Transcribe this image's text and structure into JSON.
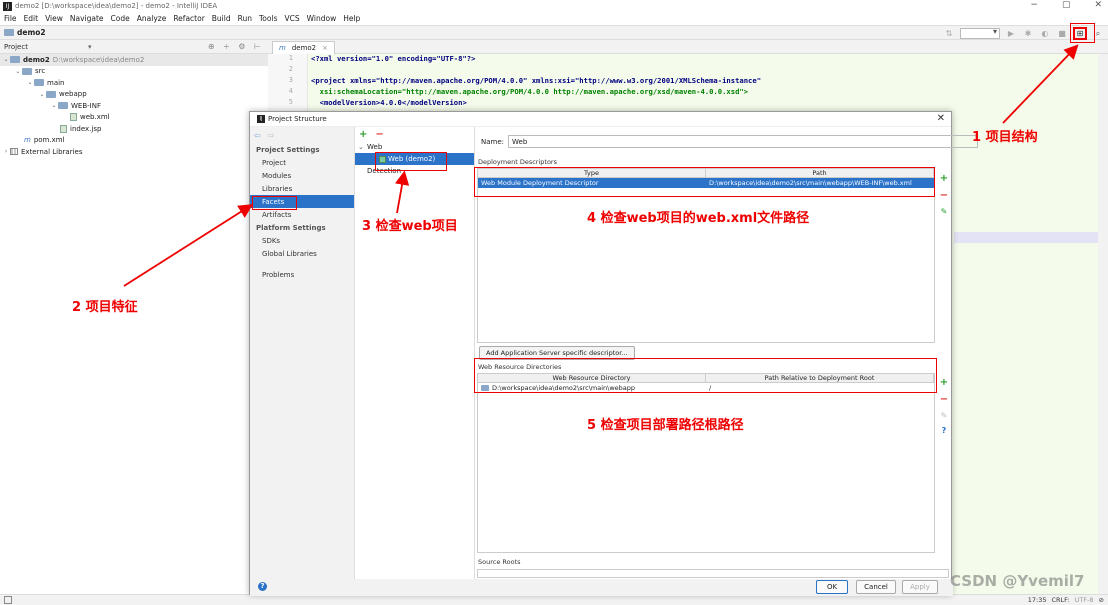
{
  "window": {
    "title": "demo2 [D:\\workspace\\idea\\demo2] - demo2 - IntelliJ IDEA",
    "controls": [
      "−",
      "▢",
      "✕"
    ]
  },
  "menu": [
    "File",
    "Edit",
    "View",
    "Navigate",
    "Code",
    "Analyze",
    "Refactor",
    "Build",
    "Run",
    "Tools",
    "VCS",
    "Window",
    "Help"
  ],
  "navbar": {
    "crumb": "demo2"
  },
  "project_panel": {
    "title": "Project",
    "tree": [
      {
        "label": "demo2",
        "muted": "D:\\workspace\\idea\\demo2"
      },
      {
        "label": "src"
      },
      {
        "label": "main"
      },
      {
        "label": "webapp"
      },
      {
        "label": "WEB-INF"
      },
      {
        "label": "web.xml"
      },
      {
        "label": "index.jsp"
      },
      {
        "label": "pom.xml"
      },
      {
        "label": "External Libraries"
      }
    ]
  },
  "editor": {
    "tab": "demo2",
    "line_numbers": [
      "1",
      "2",
      "3",
      "4",
      "5"
    ],
    "lines": [
      {
        "a": "<?xml version=\"1.0\" encoding=\"UTF-8\"?>"
      },
      {
        "a": ""
      },
      {
        "a": "<project xmlns=\"http://maven.apache.org/POM/4.0.0\" xmlns:xsi=\"http://www.w3.org/2001/XMLSchema-instance\""
      },
      {
        "a": "  xsi:schemaLocation=\"http://maven.apache.org/POM/4.0.0 http://maven.apache.org/xsd/maven-4.0.0.xsd\">"
      },
      {
        "a": "  <modelVersion>4.0.0</modelVersion>"
      }
    ]
  },
  "status": {
    "time": "17:35",
    "crlf": "CRLF:",
    "enc": "UTF-8"
  },
  "dialog": {
    "title": "Project Structure",
    "close": "✕",
    "left": {
      "project_settings": "Project Settings",
      "project_items": [
        "Project",
        "Modules",
        "Libraries",
        "Facets",
        "Artifacts"
      ],
      "platform_settings": "Platform Settings",
      "platform_items": [
        "SDKs",
        "Global Libraries"
      ],
      "problems": "Problems"
    },
    "middle": {
      "web": "Web",
      "facet": "Web (demo2)",
      "detection": "Detection"
    },
    "right": {
      "name_label": "Name:",
      "name_value": "Web",
      "deployment_descriptors": "Deployment Descriptors",
      "dd_headers": [
        "Type",
        "Path"
      ],
      "dd_row": [
        "Web Module Deployment Descriptor",
        "D:\\workspace\\idea\\demo2\\src\\main\\webapp\\WEB-INF\\web.xml"
      ],
      "add_server_btn": "Add Application Server specific descriptor...",
      "web_resource_dirs": "Web Resource Directories",
      "wr_headers": [
        "Web Resource Directory",
        "Path Relative to Deployment Root"
      ],
      "wr_row": [
        "D:\\workspace\\idea\\demo2\\src\\main\\webapp",
        "/"
      ],
      "source_roots": "Source Roots"
    },
    "buttons": {
      "ok": "OK",
      "cancel": "Cancel",
      "apply": "Apply"
    }
  },
  "annotations": {
    "a1": "1 项目结构",
    "a2": "2 项目特征",
    "a3": "3 检查web项目",
    "a4": "4 检查web项目的web.xml文件路径",
    "a5": "5 检查项目部署路径根路径"
  },
  "watermark": "CSDN @Yvemil7",
  "colors": {
    "accent": "#2b72c9",
    "annotation": "#ee0000",
    "code_bg": "#f4fbea"
  }
}
